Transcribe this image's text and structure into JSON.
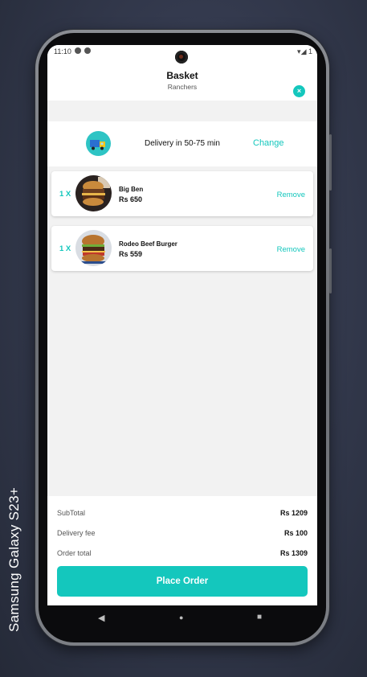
{
  "device": {
    "label": "Samsung Galaxy  S23+"
  },
  "statusbar": {
    "time": "11:10",
    "right": "▾◢ 1"
  },
  "header": {
    "title": "Basket",
    "subtitle": "Ranchers",
    "close": "×"
  },
  "delivery": {
    "text": "Delivery in 50-75 min",
    "change_label": "Change",
    "icon": "delivery-truck-icon"
  },
  "items": [
    {
      "qty": "1 X",
      "name": "Big Ben",
      "price": "Rs 650",
      "remove_label": "Remove"
    },
    {
      "qty": "1 X",
      "name": "Rodeo Beef Burger",
      "price": "Rs 559",
      "remove_label": "Remove"
    }
  ],
  "summary": {
    "subtotal_label": "SubTotal",
    "subtotal_value": "Rs 1209",
    "delivery_fee_label": "Delivery fee",
    "delivery_fee_value": "Rs 100",
    "order_total_label": "Order total",
    "order_total_value": "Rs 1309",
    "place_order_label": "Place Order"
  },
  "navbar": {
    "back": "◀",
    "home": "●",
    "recent": "■"
  },
  "colors": {
    "accent": "#14c7bd",
    "screen_bg": "#f2f2f2"
  }
}
